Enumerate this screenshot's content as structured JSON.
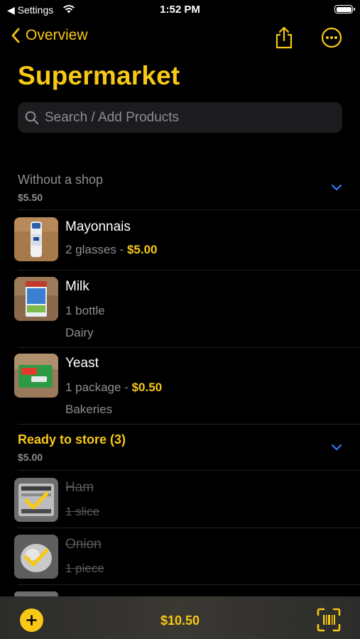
{
  "status_bar": {
    "back_app": "Settings",
    "time": "1:52 PM"
  },
  "nav": {
    "back_label": "Overview"
  },
  "title": "Supermarket",
  "search": {
    "placeholder": "Search / Add Products"
  },
  "section_without_shop": {
    "title": "Without a shop",
    "total": "$5.50",
    "items": [
      {
        "name": "Mayonnais",
        "quantity": "2 glasses -",
        "price": "$5.00",
        "category": ""
      },
      {
        "name": "Milk",
        "quantity": "1 bottle",
        "price": "",
        "category": "Dairy"
      },
      {
        "name": "Yeast",
        "quantity": "1 package -",
        "price": "$0.50",
        "category": "Bakeries"
      }
    ]
  },
  "section_ready": {
    "title": "Ready to store (3)",
    "total": "$5.00",
    "items": [
      {
        "name": "Ham",
        "quantity": "1 slice"
      },
      {
        "name": "Onion",
        "quantity": "1 piece"
      }
    ]
  },
  "tab_bar": {
    "total": "$10.50"
  },
  "colors": {
    "accent": "#f7c816",
    "chevron": "#2f7df6",
    "background": "#000000"
  }
}
